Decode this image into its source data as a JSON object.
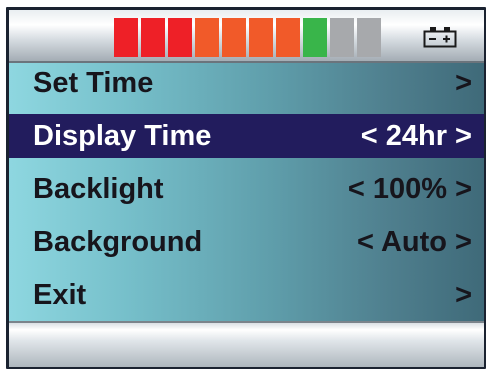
{
  "status": {
    "battery_icon": "battery-icon",
    "meter": {
      "segments_total": 10,
      "segments_lit": 8,
      "segment_colors": [
        "#ee2027",
        "#ee2027",
        "#ee2027",
        "#f15a29",
        "#f15a29",
        "#f15a29",
        "#f15a29",
        "#39b54a",
        "#a7a9ac",
        "#a7a9ac"
      ]
    }
  },
  "menu": {
    "items": [
      {
        "label": "Set Time",
        "value": ">"
      },
      {
        "label": "Display Time",
        "value": "< 24hr >"
      },
      {
        "label": "Backlight",
        "value": "< 100% >"
      },
      {
        "label": "Background",
        "value": "< Auto >"
      },
      {
        "label": "Exit",
        "value": ">"
      }
    ],
    "selected_index": 1
  },
  "colors": {
    "selected_bg": "#221c5d",
    "selected_text": "#ffffff",
    "text": "#17151c"
  }
}
